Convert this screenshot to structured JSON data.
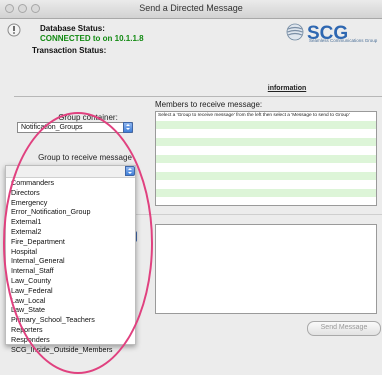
{
  "window": {
    "title": "Send a Directed Message"
  },
  "status": {
    "db_label": "Database Status:",
    "db_value": "CONNECTED to  on 10.1.1.8",
    "tx_label": "Transaction Status:"
  },
  "logo": {
    "text": "SCG",
    "subtitle": "Seamless Communications Group",
    "color": "#2e67b1"
  },
  "information_link": "information",
  "group_container": {
    "label": "Group container:",
    "value": "Notification_Groups"
  },
  "group_receive": {
    "label": "Group to receive message"
  },
  "members": {
    "label": "Members to receive message:",
    "hint": "Select a 'Group to receive message' from the left then select a 'Message to send to Group'"
  },
  "dropdown_options": [
    "Commanders",
    "Directors",
    "Emergency",
    "Error_Notification_Group",
    "External1",
    "External2",
    "Fire_Department",
    "Hospital",
    "Internal_General",
    "Internal_Staff",
    "Law_County",
    "Law_Federal",
    "Law_Local",
    "Law_State",
    "Primary_School_Teachers",
    "Reporters",
    "Responders",
    "SCG_Inside_Outside_Members"
  ],
  "send_button": "Send Message",
  "colors": {
    "connected": "#128a12",
    "annotation_circle": "#e0417f",
    "member_row_alt": "#ddf5d8"
  }
}
